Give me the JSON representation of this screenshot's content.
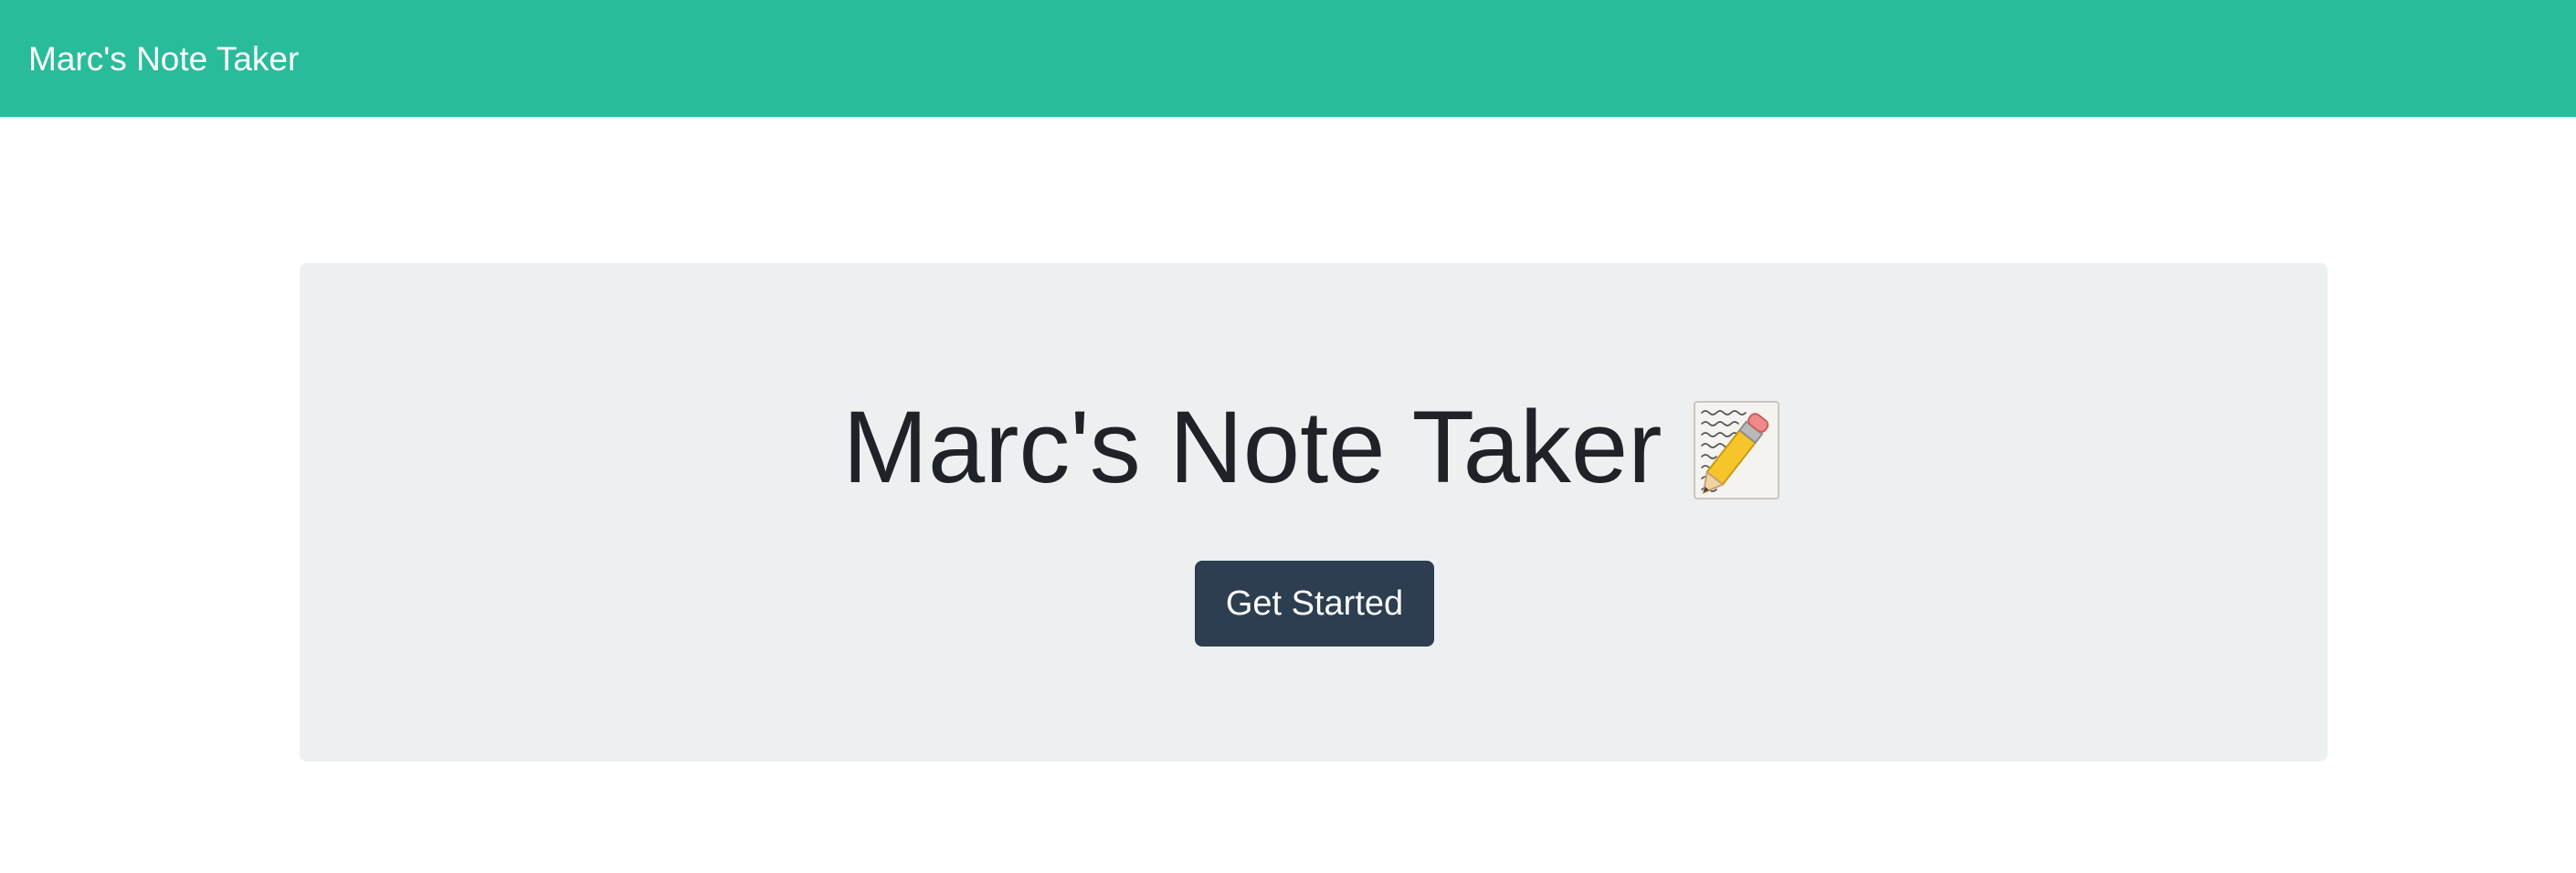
{
  "navbar": {
    "brand": "Marc's Note Taker",
    "background": "#29bc9b"
  },
  "jumbotron": {
    "title": "Marc's Note Taker",
    "icon": "memo-icon",
    "background": "#ecf0f1",
    "button": {
      "label": "Get Started",
      "background": "#2c3e50"
    }
  }
}
